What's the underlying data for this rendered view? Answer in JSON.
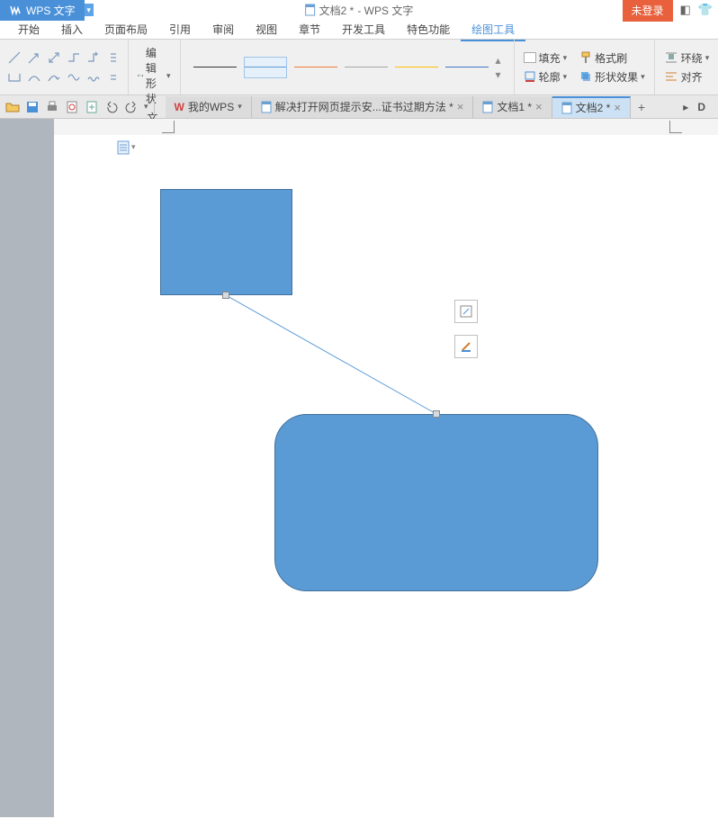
{
  "title": {
    "doc": "文档2 *",
    "app_suffix": " - WPS 文字",
    "app_menu": "WPS 文字"
  },
  "login": {
    "label": "未登录"
  },
  "menus": {
    "start": "开始",
    "insert": "插入",
    "page": "页面布局",
    "ref": "引用",
    "review": "审阅",
    "view": "视图",
    "chapter": "章节",
    "dev": "开发工具",
    "special": "特色功能",
    "draw": "绘图工具"
  },
  "ribbon": {
    "edit_shape": "编辑形状",
    "textbox": "文本框",
    "fill": "填充",
    "format_painter": "格式刷",
    "outline": "轮廓",
    "shape_effect": "形状效果",
    "wrap": "环绕",
    "align": "对齐"
  },
  "tabs": {
    "wps_home": "我的WPS",
    "long_doc": "解决打开网页提示安...证书过期方法 *",
    "doc1": "文档1 *",
    "doc2": "文档2 *"
  },
  "icons": {
    "wlogo": "W",
    "doc": "doc",
    "shirt": "👕",
    "skin": "🎨"
  }
}
